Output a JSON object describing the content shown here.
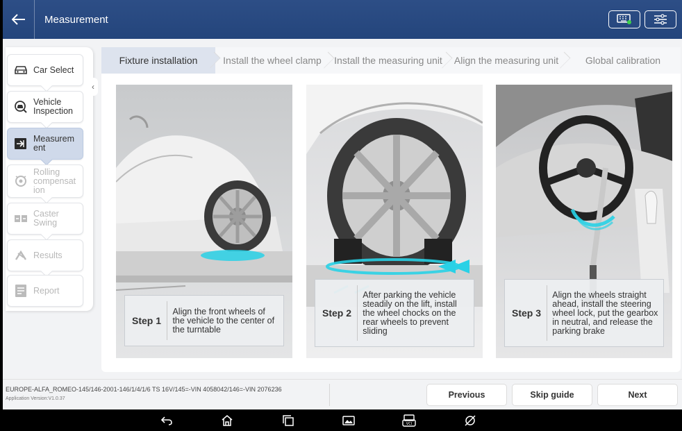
{
  "header": {
    "title": "Measurement"
  },
  "sidebar": {
    "items": [
      {
        "label": "Car Select",
        "icon": "car-icon",
        "state": "normal"
      },
      {
        "label": "Vehicle Inspection",
        "icon": "inspection-icon",
        "state": "normal"
      },
      {
        "label": "Measurement",
        "icon": "measurement-icon",
        "state": "active"
      },
      {
        "label": "Rolling compensation",
        "icon": "rolling-icon",
        "state": "disabled"
      },
      {
        "label": "Caster Swing",
        "icon": "caster-icon",
        "state": "disabled"
      },
      {
        "label": "Results",
        "icon": "results-icon",
        "state": "disabled"
      },
      {
        "label": "Report",
        "icon": "report-icon",
        "state": "disabled"
      }
    ],
    "display_lines": [
      [
        "Car Select"
      ],
      [
        "Vehicle",
        "Inspection"
      ],
      [
        "Measurem",
        "ent"
      ],
      [
        "Rolling",
        "compensat",
        "ion"
      ],
      [
        "Caster",
        "Swing"
      ],
      [
        "Results"
      ],
      [
        "Report"
      ]
    ]
  },
  "steps": [
    {
      "label": "Fixture installation",
      "active": true
    },
    {
      "label": "Install the wheel clamp",
      "active": false
    },
    {
      "label": "Install the measuring unit",
      "active": false
    },
    {
      "label": "Align the measuring unit",
      "active": false
    },
    {
      "label": "Global calibration",
      "active": false
    }
  ],
  "panels": [
    {
      "step": "Step 1",
      "text": "Align the front wheels of the vehicle to the center of the turntable"
    },
    {
      "step": "Step 2",
      "text": "After parking the vehicle steadily on the lift, install the wheel chocks on the rear wheels to prevent sliding"
    },
    {
      "step": "Step 3",
      "text": "Align the wheels straight ahead, install the steering wheel lock, put the gearbox in neutral, and release the parking brake"
    }
  ],
  "status": {
    "vehicle": "EUROPE-ALFA_ROMEO-145/146-2001-146/1/4/1/6 TS 16V/145=-VIN 4058042/146=-VIN 2076236",
    "version": "Application Version:V1.0.37"
  },
  "buttons": {
    "previous": "Previous",
    "skip": "Skip guide",
    "next": "Next"
  },
  "colors": {
    "header": "#24457c",
    "accent_cyan": "#29d1e6",
    "active_step": "#dde3ee"
  }
}
